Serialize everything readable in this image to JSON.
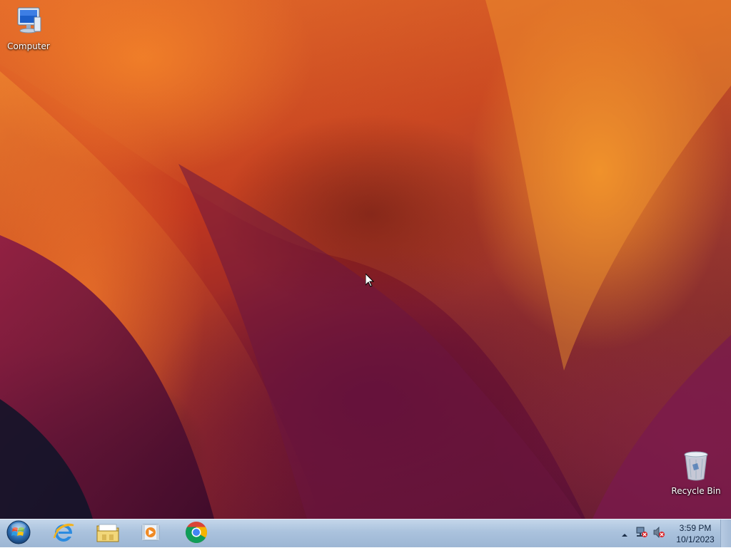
{
  "desktop": {
    "icons": [
      {
        "label": "Computer",
        "icon": "computer-icon"
      },
      {
        "label": "Recycle Bin",
        "icon": "recycle-bin-icon"
      }
    ],
    "wallpaper_colors": [
      "#e66b2a",
      "#c2381f",
      "#7a1b2e",
      "#4b0d33",
      "#f5962a"
    ]
  },
  "taskbar": {
    "start": {
      "icon": "windows-start-icon"
    },
    "pinned": [
      {
        "icon": "internet-explorer-icon"
      },
      {
        "icon": "file-explorer-icon"
      },
      {
        "icon": "media-player-icon"
      },
      {
        "icon": "chrome-icon"
      }
    ],
    "tray": {
      "icons": [
        "show-hidden-icons-arrow",
        "network-disconnected-icon",
        "volume-muted-icon"
      ],
      "time": "3:59 PM",
      "date": "10/1/2023"
    }
  }
}
